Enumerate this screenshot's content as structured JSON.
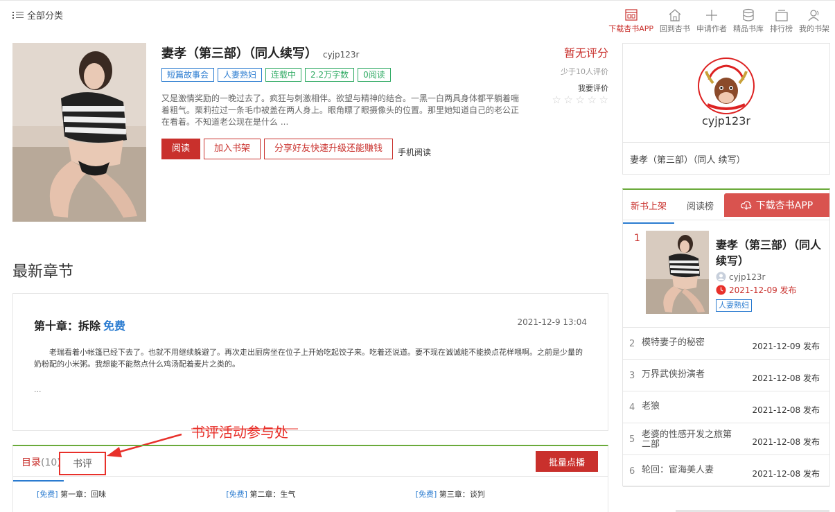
{
  "header": {
    "all_categories": "全部分类",
    "nav": [
      {
        "label": "下载杏书APP",
        "icon": "app-download-icon"
      },
      {
        "label": "回到杏书",
        "icon": "home-icon"
      },
      {
        "label": "申请作者",
        "icon": "plus-icon"
      },
      {
        "label": "精品书库",
        "icon": "database-icon"
      },
      {
        "label": "排行榜",
        "icon": "ranking-icon"
      },
      {
        "label": "我的书架",
        "icon": "user-icon"
      }
    ]
  },
  "book": {
    "title": "妻孝（第三部）（同人续写）",
    "author": "cyjp123r",
    "tags": [
      "短篇故事会",
      "人妻熟妇",
      "连载中",
      "2.2万字数",
      "0阅读"
    ],
    "description": "又是激情奖励的一晚过去了。疯狂与刺激相伴。欲望与精神的结合。一黑一白两具身体都平躺着喘着粗气。栗莉拉过一条毛巾被盖在两人身上。眼角瞟了眼摄像头的位置。那里她知道自己的老公正在看着。不知道老公现在是什么 ...",
    "read_button": "阅读",
    "shelf_button": "加入书架",
    "share_button": "分享好友快速升级还能赚钱",
    "mobile_read": "手机阅读"
  },
  "rating": {
    "score_text": "暂无评分",
    "count_text": "少于10人评价",
    "rate_label": "我要评价",
    "stars": 5
  },
  "author_card": {
    "name": "cyjp123r",
    "book": "妻孝（第三部）（同人 续写）"
  },
  "side": {
    "tabs": [
      "新书上架",
      "阅读榜"
    ],
    "download_label": "下载杏书APP",
    "top_item": {
      "rank": "1",
      "title": "妻孝（第三部）（同人续写）",
      "author": "cyjp123r",
      "date": "2021-12-09 发布",
      "tag": "人妻熟妇"
    },
    "rows": [
      {
        "rank": "2",
        "title": "模特妻子的秘密",
        "date": "2021-12-09 发布"
      },
      {
        "rank": "3",
        "title": "万界武侠扮演者",
        "date": "2021-12-08 发布"
      },
      {
        "rank": "4",
        "title": "老狼",
        "date": "2021-12-08 发布"
      },
      {
        "rank": "5",
        "title": "老婆的性感开发之旅第二部",
        "date": "2021-12-08 发布"
      },
      {
        "rank": "6",
        "title": "轮回：宦海美人妻",
        "date": "2021-12-08 发布"
      }
    ]
  },
  "latest": {
    "heading": "最新章节",
    "chapter_title": "第十章：拆除",
    "free_label": "免费",
    "time": "2021-12-9 13:04",
    "text": "老瑞看着小帐篷已经下去了。也就不用继续躲避了。再次走出厨房坐在位子上开始吃起饺子来。吃着还说道。要不现在诚诚能不能换点花样喂啊。之前是少量的奶粉配的小米粥。我想能不能熬点什么鸡汤配着麦片之类的。",
    "ellipsis": "..."
  },
  "annotation": {
    "text": "书评活动参与处",
    "color": "#e8302a"
  },
  "catalog": {
    "dir_label": "目录",
    "dir_count": "(10)",
    "review_label": "书评",
    "batch_label": "批量点播",
    "chapters": [
      {
        "free": "[免费]",
        "title": "第一章：回味"
      },
      {
        "free": "[免费]",
        "title": "第二章：生气"
      },
      {
        "free": "[免费]",
        "title": "第三章：谈判"
      }
    ]
  },
  "colors": {
    "accent": "#c9302c",
    "link": "#2a7bd0",
    "green": "#6aaa3a"
  }
}
